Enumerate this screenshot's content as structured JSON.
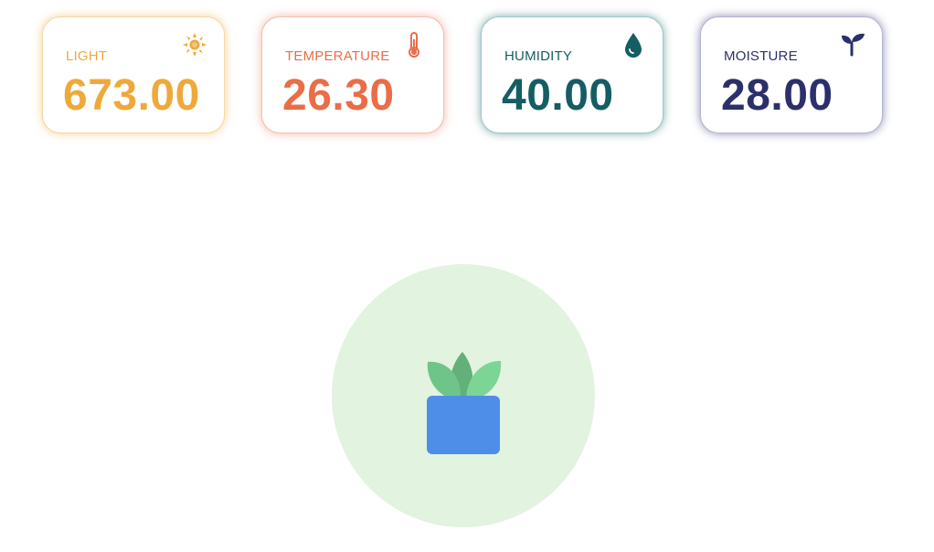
{
  "cards": [
    {
      "id": "light",
      "label": "LIGHT",
      "value": "673.00",
      "icon": "sun-icon",
      "color": "#efa93a"
    },
    {
      "id": "temperature",
      "label": "TEMPERATURE",
      "value": "26.30",
      "icon": "thermometer-icon",
      "color": "#ea6d47"
    },
    {
      "id": "humidity",
      "label": "HUMIDITY",
      "value": "40.00",
      "icon": "water-drop-icon",
      "color": "#145d63"
    },
    {
      "id": "moisture",
      "label": "MOISTURE",
      "value": "28.00",
      "icon": "sprout-icon",
      "color": "#2b306c"
    }
  ],
  "plant": {
    "icon": "potted-plant-icon",
    "circle_color": "#e2f3df",
    "pot_color": "#4f8ee8",
    "leaf_color": "#6fc48a"
  }
}
